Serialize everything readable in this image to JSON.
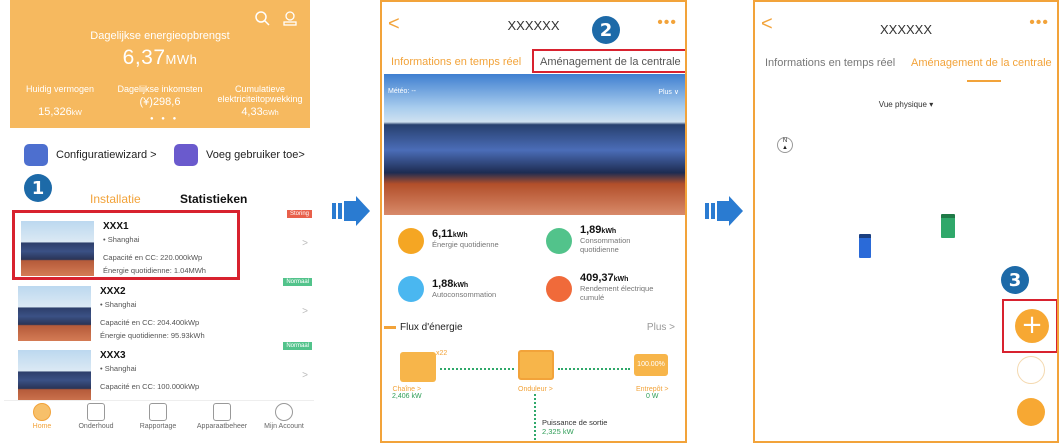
{
  "screen1": {
    "header": {
      "title": "Dagelijkse energieopbrengst",
      "value": "6,37",
      "unit": "MWh",
      "stats": [
        {
          "label": "Huidig vermogen",
          "value": "15,326",
          "unit": "kW"
        },
        {
          "label": "Dagelijkse inkomsten",
          "value": "(¥)298,6",
          "unit": ""
        },
        {
          "label": "Cumulatieve elektriciteitopwekking",
          "value": "4,33",
          "unit": "GWh"
        }
      ]
    },
    "shortcuts": {
      "wizard": "Configuratiewizard >",
      "add_user": "Voeg gebruiker toe>"
    },
    "step": "1",
    "tabs": {
      "installation": "Installatie",
      "stats": "Statistieken"
    },
    "plants": [
      {
        "name": "XXX1",
        "location": "Shanghai",
        "capacity": "Capacité en CC: 220.000kWp",
        "energy": "Énergie quotidienne: 1.04MWh",
        "status": "Storing",
        "status_color": "#e8604b"
      },
      {
        "name": "XXX2",
        "location": "Shanghai",
        "capacity": "Capacité en CC: 204.400kWp",
        "energy": "Énergie quotidienne: 95.93kWh",
        "status": "Normaal",
        "status_color": "#52c38b"
      },
      {
        "name": "XXX3",
        "location": "Shanghai",
        "capacity": "Capacité en CC: 100.000kWp",
        "energy": "",
        "status": "Normaal",
        "status_color": "#52c38b"
      }
    ],
    "nav": [
      "Home",
      "Onderhoud",
      "Rapportage",
      "Apparaatbeheer",
      "Mijn Account"
    ]
  },
  "screen2": {
    "title": "XXXXXX",
    "more": "•••",
    "step": "2",
    "tabs": {
      "realtime": "Informations en temps réel",
      "layout": "Aménagement de la centrale"
    },
    "weather": "Météo: --",
    "plus_label": "Plus ∨",
    "metrics": [
      {
        "value": "6,11",
        "unit": "kWh",
        "label": "Énergie quotidienne",
        "color": "#f5a623"
      },
      {
        "value": "1,89",
        "unit": "kWh",
        "label": "Consommation quotidienne",
        "color": "#52c38b"
      },
      {
        "value": "1,88",
        "unit": "kWh",
        "label": "Autoconsommation",
        "color": "#4ab7f0"
      },
      {
        "value": "409,37",
        "unit": "kWh",
        "label": "Rendement électrique cumulé",
        "color": "#f06a3a"
      }
    ],
    "flow": {
      "title": "Flux d'énergie",
      "more": "Plus >",
      "string_count": "x22",
      "chain_label": "Chaîne >",
      "chain_value": "2,406 kW",
      "inverter_label": "Onduleur >",
      "storage_label": "Entrepôt >",
      "storage_value": "0 W",
      "storage_pct": "100.00%",
      "output_label": "Puissance de sortie",
      "output_value": "2,325 kW"
    }
  },
  "screen3": {
    "title": "XXXXXX",
    "more": "•••",
    "step": "3",
    "tabs": {
      "realtime": "Informations en temps réel",
      "layout": "Aménagement de la centrale"
    },
    "view": "Vue physique ▾",
    "compass": "N",
    "add": "+"
  },
  "colors": {
    "accent": "#f2a33a",
    "highlight": "#d8222f",
    "step_badge": "#1d6aa8",
    "arrow": "#2a7bd1"
  }
}
